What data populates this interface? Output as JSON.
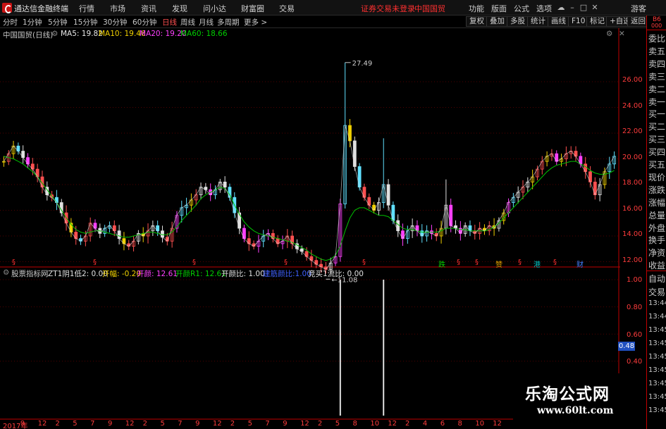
{
  "app": {
    "title": "通达信金融终端",
    "menu": [
      "行情",
      "市场",
      "资讯",
      "发现",
      "问小达",
      "财富圈",
      "交易"
    ],
    "notice": "证券交易未登录",
    "stock_name": "中国国贸",
    "top_right": [
      "功能",
      "版面",
      "公式",
      "选项"
    ],
    "guest": "游客"
  },
  "periods": {
    "items": [
      "分时",
      "1分钟",
      "5分钟",
      "15分钟",
      "30分钟",
      "60分钟",
      "日线",
      "周线",
      "月线",
      "多周期",
      "更多 >"
    ],
    "active": "日线"
  },
  "tools": [
    "复权",
    "叠加",
    "多股",
    "统计",
    "画线",
    "F10",
    "标记",
    "+自选",
    "返回"
  ],
  "upper_header": {
    "title": "中国国贸(日线)",
    "ma5": "MA5: 19.82",
    "ma10": "MA10: 19.46",
    "ma20": "MA20: 19.20",
    "ma60": "MA60: 18.66",
    "colors": {
      "ma5": "#e8e8e8",
      "ma10": "#f0d000",
      "ma20": "#ff40ff",
      "ma60": "#00d000"
    }
  },
  "lower_header": {
    "title": "股票指标网",
    "zt": "ZT1阴1低2: 0.00",
    "kaifu": "开幅: -0.20",
    "kaimai": "开颜: 12.61",
    "kaimai_r": "开颜R1: 12.61",
    "kaimai_bi": "开颜比: 1.00",
    "blue": "建筋颜比:1.00",
    "jingmai": "竞买1流比: 0.00"
  },
  "right_panel": {
    "corner_top": "B6",
    "corner_bottom": "000",
    "quote_labels": [
      "委比",
      "卖五",
      "卖四",
      "卖三",
      "卖二",
      "卖一",
      "买一",
      "买二",
      "买三",
      "买四",
      "买五",
      "现价",
      "涨跌",
      "涨幅",
      "总量",
      "外盘",
      "换手",
      "净资",
      "收益"
    ],
    "lower_labels": [
      "自动",
      "交易",
      "13:44",
      "13:44",
      "13:45",
      "13:45",
      "13:45",
      "13:45",
      "13:45",
      "13:45",
      "13:45"
    ]
  },
  "chart_data": [
    {
      "type": "candlestick",
      "title": "中国国贸(日线)",
      "ylim": [
        11.0,
        27.8
      ],
      "yticks": [
        "26.00",
        "24.00",
        "22.00",
        "20.00",
        "18.00",
        "16.00",
        "14.00",
        "12.00"
      ],
      "annotations": {
        "high": "27.49",
        "low": "11.08"
      },
      "close_series": [
        19.8,
        20.4,
        21.0,
        20.6,
        20.1,
        19.6,
        19.2,
        18.6,
        17.8,
        17.2,
        17.0,
        16.6,
        15.8,
        15.0,
        14.3,
        13.8,
        13.6,
        14.0,
        15.0,
        14.6,
        14.2,
        14.6,
        14.8,
        14.4,
        13.8,
        13.4,
        13.2,
        13.6,
        14.2,
        14.0,
        14.4,
        14.8,
        14.4,
        13.9,
        13.6,
        14.6,
        15.6,
        16.2,
        16.4,
        16.8,
        17.2,
        17.8,
        17.6,
        17.2,
        17.6,
        18.2,
        17.8,
        17.0,
        15.8,
        14.6,
        13.8,
        13.4,
        13.2,
        13.6,
        14.0,
        14.2,
        13.8,
        13.4,
        13.6,
        14.0,
        13.4,
        13.0,
        12.8,
        12.4,
        12.1,
        11.8,
        11.6,
        11.4,
        11.9,
        12.4,
        16.5,
        22.6,
        21.4,
        19.4,
        17.8,
        17.0,
        16.4,
        16.0,
        16.6,
        18.0,
        16.4,
        15.2,
        14.4,
        13.8,
        14.4,
        14.8,
        14.4,
        14.0,
        14.4,
        14.2,
        14.0,
        14.6,
        16.4,
        14.8,
        14.6,
        14.2,
        14.8,
        14.4,
        14.2,
        14.6,
        14.4,
        14.8,
        14.6,
        15.2,
        15.8,
        16.6,
        17.0,
        17.4,
        17.8,
        18.2,
        18.6,
        19.2,
        19.8,
        20.2,
        20.4,
        19.8,
        20.0,
        20.4,
        20.6,
        20.2,
        19.6,
        19.0,
        18.2,
        17.2,
        18.0,
        19.0,
        19.6,
        20.2
      ],
      "ma60_series": [
        20.2,
        20.1,
        20.0,
        19.8,
        19.6,
        19.3,
        19.0,
        18.6,
        18.1,
        17.6,
        17.1,
        16.6,
        16.0,
        15.4,
        14.9,
        14.5,
        14.3,
        14.2,
        14.3,
        14.4,
        14.4,
        14.3,
        14.2,
        14.1,
        14.0,
        13.9,
        13.9,
        14.0,
        14.1,
        14.2,
        14.3,
        14.3,
        14.2,
        14.1,
        14.1,
        14.3,
        14.7,
        15.2,
        15.6,
        16.0,
        16.4,
        16.9,
        17.2,
        17.4,
        17.6,
        17.8,
        17.7,
        17.2,
        16.4,
        15.7,
        15.1,
        14.7,
        14.4,
        14.2,
        14.1,
        14.0,
        13.9,
        13.8,
        13.7,
        13.6,
        13.5,
        13.3,
        13.1,
        12.9,
        12.6,
        12.4,
        12.2,
        12.1,
        12.2,
        12.5,
        13.2,
        14.4,
        15.4,
        16.0,
        16.2,
        16.2,
        16.0,
        15.8,
        15.6,
        15.6,
        15.5,
        15.2,
        14.9,
        14.6,
        14.5,
        14.5,
        14.4,
        14.3,
        14.3,
        14.3,
        14.3,
        14.4,
        14.6,
        14.6,
        14.6,
        14.5,
        14.5,
        14.4,
        14.4,
        14.4,
        14.4,
        14.5,
        14.7,
        15.0,
        15.4,
        15.8,
        16.2,
        16.6,
        17.0,
        17.4,
        17.8,
        18.2,
        18.6,
        19.0,
        19.3,
        19.5,
        19.6,
        19.7,
        19.8,
        19.8,
        19.6,
        19.4,
        19.1,
        18.9,
        18.8,
        18.8,
        18.9,
        19.1
      ]
    },
    {
      "type": "bar",
      "title": "股票指标网",
      "ylim": [
        0.2,
        1.1
      ],
      "yticks": [
        "1.00",
        "0.80",
        "0.60",
        "0.40"
      ],
      "current_marker": "0.48",
      "spikes": [
        {
          "x_index": 70,
          "value": 1.0
        },
        {
          "x_index": 79,
          "value": 1.0
        }
      ]
    }
  ],
  "x_axis_labels": [
    "2017年",
    "9",
    "12",
    "2",
    "5",
    "7",
    "9",
    "12",
    "2",
    "5",
    "7",
    "9",
    "12",
    "2",
    "5",
    "7",
    "9",
    "12",
    "2",
    "5",
    "8",
    "10",
    "12",
    "2",
    "4",
    "6",
    "8",
    "10",
    "12"
  ],
  "event_markers": [
    {
      "label": "§",
      "color": "#ff3030"
    },
    {
      "label": "§",
      "color": "#ff3030"
    },
    {
      "label": "§",
      "color": "#ff3030"
    },
    {
      "label": "§",
      "color": "#ff3030"
    },
    {
      "label": "§",
      "color": "#ff3030"
    },
    {
      "label": "跌",
      "color": "#00d000"
    },
    {
      "label": "§",
      "color": "#ff3030"
    },
    {
      "label": "§",
      "color": "#ff3030"
    },
    {
      "label": "赞",
      "color": "#e0a000"
    },
    {
      "label": "§",
      "color": "#ff3030"
    },
    {
      "label": "港",
      "color": "#00c0c0"
    },
    {
      "label": "§",
      "color": "#ff3030"
    },
    {
      "label": "财",
      "color": "#4080ff"
    }
  ],
  "watermark": {
    "cn": "乐淘公式网",
    "url": "www.60lt.com"
  }
}
